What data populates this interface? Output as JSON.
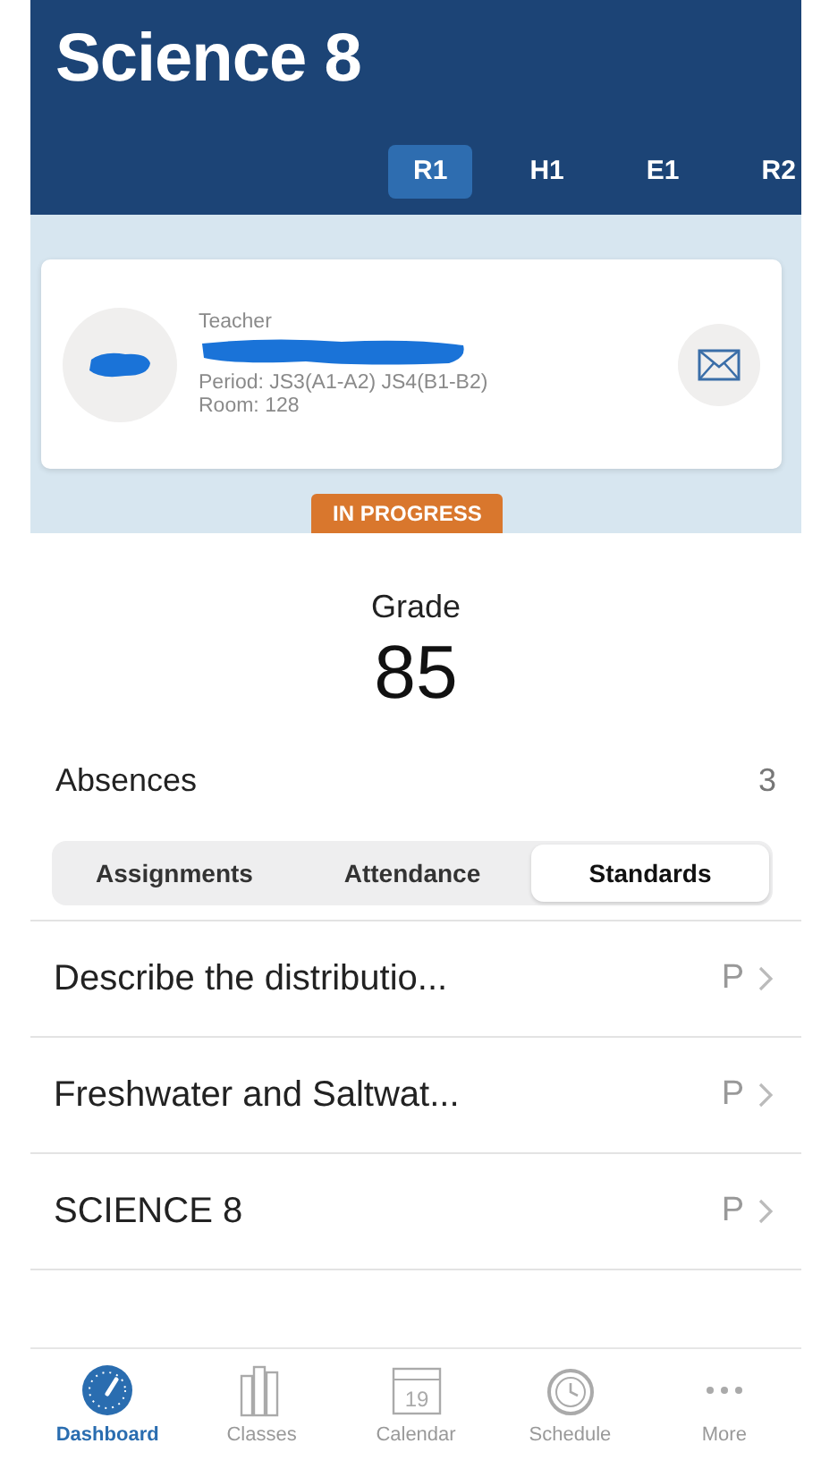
{
  "header": {
    "title": "Science 8"
  },
  "tabs": [
    {
      "label": "R1",
      "selected": true
    },
    {
      "label": "H1",
      "selected": false
    },
    {
      "label": "E1",
      "selected": false
    },
    {
      "label": "R2",
      "selected": false
    }
  ],
  "teacher_card": {
    "role": "Teacher",
    "period": "Period: JS3(A1-A2) JS4(B1-B2)",
    "room": "Room: 128"
  },
  "status_badge": "IN PROGRESS",
  "grade": {
    "label": "Grade",
    "value": "85"
  },
  "absences": {
    "label": "Absences",
    "count": "3"
  },
  "segments": [
    {
      "label": "Assignments",
      "selected": false
    },
    {
      "label": "Attendance",
      "selected": false
    },
    {
      "label": "Standards",
      "selected": true
    }
  ],
  "standards": [
    {
      "title": "Describe the distributio...",
      "mark": "P"
    },
    {
      "title": "Freshwater and Saltwat...",
      "mark": "P"
    },
    {
      "title": "SCIENCE 8",
      "mark": "P"
    }
  ],
  "bottom_tabs": [
    {
      "kind": "dashboard",
      "label": "Dashboard",
      "selected": true
    },
    {
      "kind": "classes",
      "label": "Classes",
      "selected": false
    },
    {
      "kind": "calendar",
      "label": "Calendar",
      "icon_text": "19",
      "selected": false
    },
    {
      "kind": "schedule",
      "label": "Schedule",
      "selected": false
    },
    {
      "kind": "more",
      "label": "More",
      "selected": false
    }
  ]
}
